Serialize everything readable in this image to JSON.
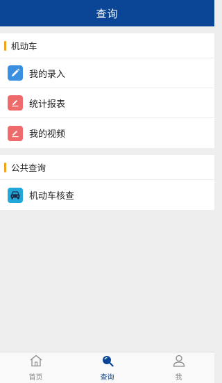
{
  "header": {
    "title": "查询"
  },
  "sections": [
    {
      "title": "机动车",
      "items": [
        {
          "label": "我的录入",
          "icon": "pencil-icon",
          "color": "#3b8fe0"
        },
        {
          "label": "统计报表",
          "icon": "edit-icon",
          "color": "#ef6b6b"
        },
        {
          "label": "我的视频",
          "icon": "edit-icon",
          "color": "#ef6b6b"
        }
      ]
    },
    {
      "title": "公共查询",
      "items": [
        {
          "label": "机动车核查",
          "icon": "car-icon",
          "color": "#22a8d8"
        }
      ]
    }
  ],
  "tabbar": {
    "items": [
      {
        "label": "首页",
        "icon": "home-icon"
      },
      {
        "label": "查询",
        "icon": "search-icon",
        "active": true
      },
      {
        "label": "我",
        "icon": "person-icon"
      }
    ]
  },
  "colors": {
    "navbar": "#0b4595",
    "section_accent": "#f3a21b",
    "background": "#eeeeee"
  }
}
